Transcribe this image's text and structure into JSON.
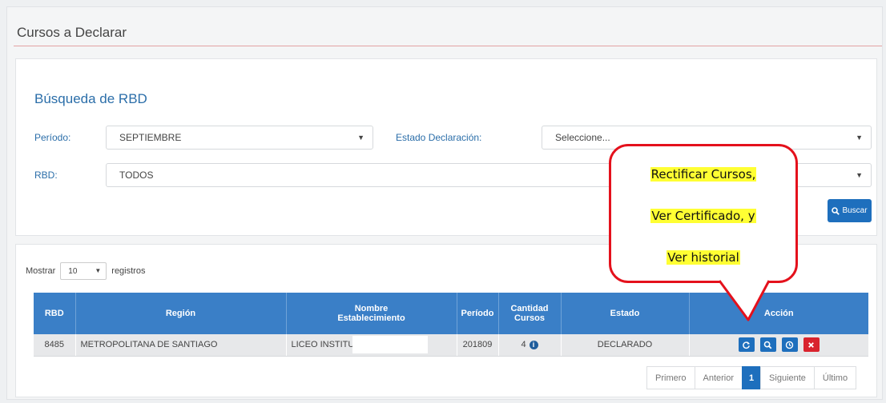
{
  "page": {
    "title": "Cursos a Declarar"
  },
  "search": {
    "title": "Búsqueda de RBD",
    "periodo_label": "Período:",
    "periodo_value": "SEPTIEMBRE",
    "estado_label": "Estado Declaración:",
    "estado_value": "Seleccione...",
    "rbd_label": "RBD:",
    "rbd_value": "TODOS",
    "buscar_label": "Buscar"
  },
  "results": {
    "mostrar_label": "Mostrar",
    "page_size": "10",
    "registros_label": "registros",
    "columns": {
      "rbd": "RBD",
      "region": "Región",
      "nombre_line1": "Nombre",
      "nombre_line2": "Establecimiento",
      "periodo": "Período",
      "cantidad_line1": "Cantidad",
      "cantidad_line2": "Cursos",
      "estado": "Estado",
      "accion": "Acción"
    },
    "rows": [
      {
        "rbd": "8485",
        "region": "METROPOLITANA DE SANTIAGO",
        "nombre": "LICEO INSTITU",
        "periodo": "201809",
        "cantidad": "4",
        "estado": "DECLARADO"
      }
    ],
    "pagination": {
      "first": "Primero",
      "prev": "Anterior",
      "current": "1",
      "next": "Siguiente",
      "last": "Último"
    }
  },
  "callout": {
    "line1": "Rectificar Cursos,",
    "line2": "Ver Certificado, y",
    "line3": "Ver historial"
  },
  "colors": {
    "primary": "#1e6fbd",
    "header": "#3a7fc7",
    "danger": "#d9232d",
    "highlight": "#ffff33",
    "callout_border": "#e4111c"
  }
}
